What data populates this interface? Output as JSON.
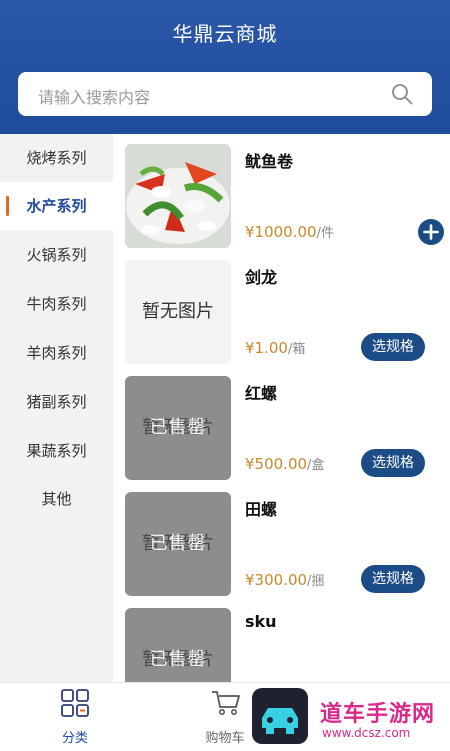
{
  "app": {
    "title": "华鼎云商城"
  },
  "search": {
    "placeholder": "请输入搜索内容"
  },
  "sidebar": {
    "items": [
      {
        "label": "烧烤系列",
        "active": false
      },
      {
        "label": "水产系列",
        "active": true
      },
      {
        "label": "火锅系列",
        "active": false
      },
      {
        "label": "牛肉系列",
        "active": false
      },
      {
        "label": "羊肉系列",
        "active": false
      },
      {
        "label": "猪副系列",
        "active": false
      },
      {
        "label": "果蔬系列",
        "active": false
      },
      {
        "label": "其他",
        "active": false
      }
    ]
  },
  "products": [
    {
      "name": "鱿鱼卷",
      "price": "¥1000.00",
      "unit": "/件",
      "image": "photo",
      "action": "add"
    },
    {
      "name": "剑龙",
      "price": "¥1.00",
      "unit": "/箱",
      "image_text": "暂无图片",
      "action_label": "选规格"
    },
    {
      "name": "红螺",
      "price": "¥500.00",
      "unit": "/盒",
      "image_text": "暂无图片",
      "overlay_text": "已售罄",
      "action_label": "选规格"
    },
    {
      "name": "田螺",
      "price": "¥300.00",
      "unit": "/捆",
      "image_text": "暂无图片",
      "overlay_text": "已售罄",
      "action_label": "选规格"
    },
    {
      "name": "sku",
      "image_text": "暂无图片",
      "overlay_text": "已售罄"
    }
  ],
  "tabbar": {
    "items": [
      {
        "label": "分类",
        "icon": "grid-icon",
        "active": true
      },
      {
        "label": "购物车",
        "icon": "cart-icon",
        "active": false
      }
    ]
  },
  "watermark": {
    "text": "道车手游网",
    "url": "www.dcsz.com"
  },
  "colors": {
    "header": "#1f4c9d",
    "accent": "#1b4c86",
    "price": "#c8892b",
    "active_marker": "#e06a1a"
  }
}
